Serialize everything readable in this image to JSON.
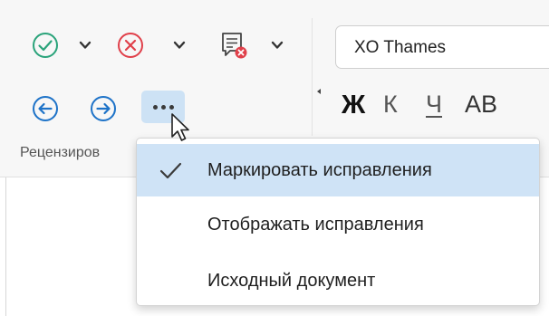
{
  "ribbon": {
    "group_label": "Рецензиров",
    "font_name": "XO Thames",
    "format_buttons": {
      "bold": "Ж",
      "italic": "К",
      "underline": "Ч",
      "strike": "АВ"
    }
  },
  "menu": {
    "items": [
      {
        "label": "Маркировать исправления",
        "checked": true
      },
      {
        "label": "Отображать исправления",
        "checked": false
      },
      {
        "label": "Исходный документ",
        "checked": false
      }
    ]
  },
  "colors": {
    "accept": "#2aa37a",
    "reject": "#e0404a",
    "nav": "#1e73c8",
    "highlight": "#cfe3f6"
  }
}
